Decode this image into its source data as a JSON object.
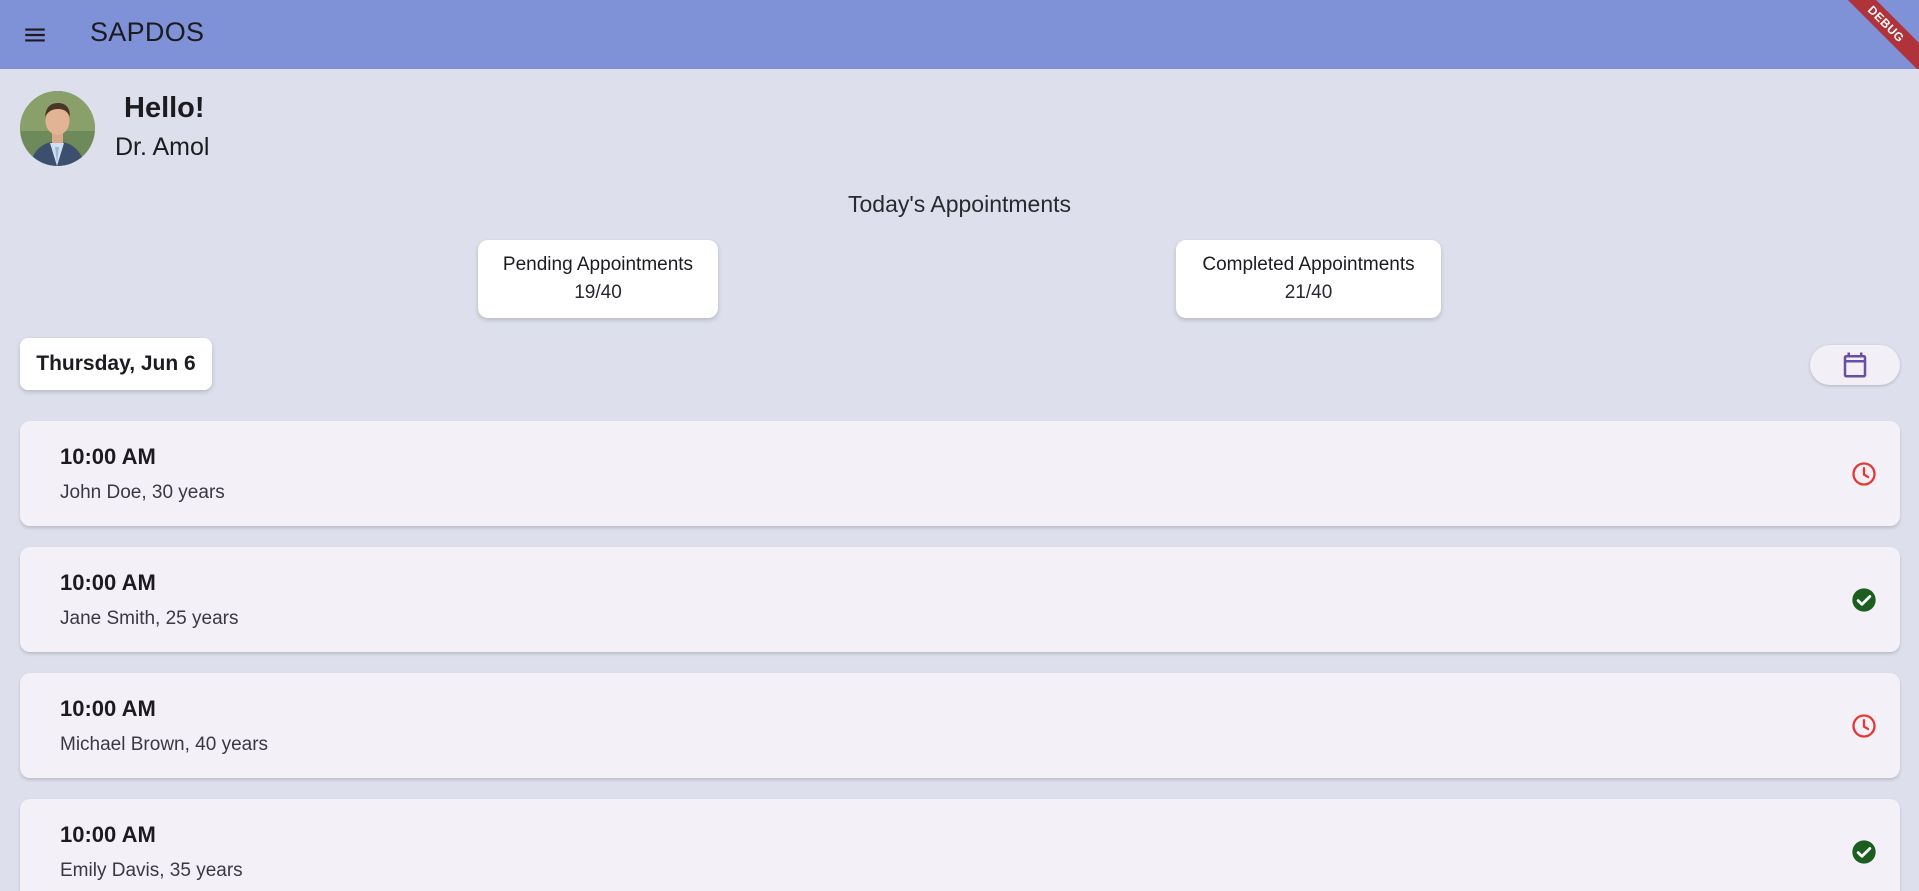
{
  "app": {
    "title": "SAPDOS",
    "debug_label": "DEBUG",
    "menu_icon": "menu-icon",
    "bar_color": "#7f92d8"
  },
  "profile": {
    "greeting": "Hello!",
    "name": "Dr. Amol",
    "avatar_icon": "doctor-avatar"
  },
  "summary": {
    "title": "Today's Appointments",
    "pending": {
      "label": "Pending Appointments",
      "value": "19/40"
    },
    "completed": {
      "label": "Completed Appointments",
      "value": "21/40"
    }
  },
  "date_selector": {
    "date": "Thursday, Jun 6",
    "calendar_icon": "calendar-icon",
    "calendar_color": "#6750a4"
  },
  "appointments": [
    {
      "time": "10:00 AM",
      "patient": "John Doe, 30 years",
      "status": "pending",
      "status_icon": "clock-icon",
      "status_color": "#e53935"
    },
    {
      "time": "10:00 AM",
      "patient": "Jane Smith, 25 years",
      "status": "completed",
      "status_icon": "check-circle-icon",
      "status_color": "#1b5e20"
    },
    {
      "time": "10:00 AM",
      "patient": "Michael Brown, 40 years",
      "status": "pending",
      "status_icon": "clock-icon",
      "status_color": "#e53935"
    },
    {
      "time": "10:00 AM",
      "patient": "Emily Davis, 35 years",
      "status": "completed",
      "status_icon": "check-circle-icon",
      "status_color": "#1b5e20"
    }
  ]
}
